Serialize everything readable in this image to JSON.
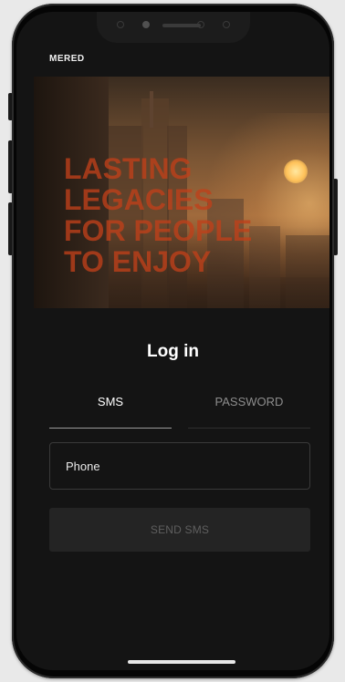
{
  "app": {
    "brand": "MERED"
  },
  "hero": {
    "tagline_lines": [
      "LASTING",
      "LEGACIES",
      "FOR PEOPLE",
      "TO ENJOY"
    ]
  },
  "login": {
    "title": "Log in",
    "tabs": [
      {
        "label": "SMS",
        "active": true
      },
      {
        "label": "PASSWORD",
        "active": false
      }
    ],
    "phone": {
      "placeholder": "Phone",
      "value": ""
    },
    "send_button_label": "SEND SMS"
  },
  "colors": {
    "background": "#141414",
    "tagline": "#c0401a",
    "active_tab_text": "#ffffff",
    "inactive_tab_text": "#8d8d8d",
    "button_bg": "#242424",
    "button_text": "#5f5f5f"
  }
}
